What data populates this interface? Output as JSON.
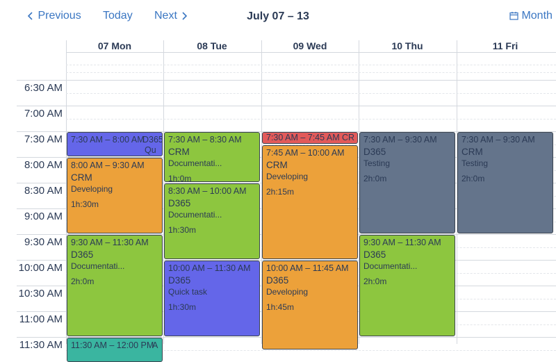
{
  "toolbar": {
    "previous_label": "Previous",
    "today_label": "Today",
    "next_label": "Next",
    "title": "July 07 – 13",
    "month_label": "Month"
  },
  "days": [
    {
      "label": "07 Mon"
    },
    {
      "label": "08 Tue"
    },
    {
      "label": "09 Wed"
    },
    {
      "label": "10 Thu"
    },
    {
      "label": "11 Fri"
    }
  ],
  "times": [
    "6:30 AM",
    "7:00 AM",
    "7:30 AM",
    "8:00 AM",
    "8:30 AM",
    "9:00 AM",
    "9:30 AM",
    "10:00 AM",
    "10:30 AM",
    "11:00 AM",
    "11:30 AM"
  ],
  "colors": {
    "purple": "#6466e9",
    "orange": "#eca13a",
    "green": "#8dc63f",
    "red": "#e25a5a",
    "slate": "#64748b",
    "teal": "#3ab5a0",
    "accent": "#3a76c2"
  },
  "events": [
    {
      "day": 0,
      "start": 7.5,
      "end": 8.0,
      "color": "purple",
      "time": "7:30 AM – 8:00 AM",
      "inline": "D365",
      "extra": "Qu",
      "title": "",
      "type": "",
      "duration": ""
    },
    {
      "day": 0,
      "start": 8.0,
      "end": 9.5,
      "color": "orange",
      "time": "8:00 AM – 9:30 AM",
      "title": "CRM",
      "type": "Developing",
      "duration": "1h:30m"
    },
    {
      "day": 0,
      "start": 9.5,
      "end": 11.5,
      "color": "green",
      "time": "9:30 AM – 11:30 AM",
      "title": "D365",
      "type": "Documentati...",
      "duration": "2h:0m"
    },
    {
      "day": 0,
      "start": 11.5,
      "end": 12.0,
      "color": "teal",
      "time": "11:30 AM – 12:00 PM",
      "inline": "A",
      "title": "",
      "type": "",
      "duration": ""
    },
    {
      "day": 1,
      "start": 7.5,
      "end": 8.5,
      "color": "green",
      "time": "7:30 AM – 8:30 AM",
      "title": "CRM",
      "type": "Documentati...",
      "duration": "1h:0m"
    },
    {
      "day": 1,
      "start": 8.5,
      "end": 10.0,
      "color": "green",
      "time": "8:30 AM – 10:00 AM",
      "title": "D365",
      "type": "Documentati...",
      "duration": "1h:30m"
    },
    {
      "day": 1,
      "start": 10.0,
      "end": 11.5,
      "color": "purple",
      "time": "10:00 AM – 11:30 AM",
      "title": "D365",
      "type": "Quick task",
      "duration": "1h:30m"
    },
    {
      "day": 2,
      "start": 7.5,
      "end": 7.75,
      "color": "red",
      "time": "7:30 AM – 7:45 AM",
      "inline": "CR",
      "title": "",
      "type": "",
      "duration": ""
    },
    {
      "day": 2,
      "start": 7.75,
      "end": 10.0,
      "color": "orange",
      "time": "7:45 AM – 10:00 AM",
      "title": "CRM",
      "type": "Developing",
      "duration": "2h:15m"
    },
    {
      "day": 2,
      "start": 10.0,
      "end": 11.75,
      "color": "orange",
      "time": "10:00 AM – 11:45 AM",
      "title": "D365",
      "type": "Developing",
      "duration": "1h:45m"
    },
    {
      "day": 3,
      "start": 7.5,
      "end": 9.5,
      "color": "slate",
      "time": "7:30 AM – 9:30 AM",
      "title": "D365",
      "type": "Testing",
      "duration": "2h:0m"
    },
    {
      "day": 3,
      "start": 9.5,
      "end": 11.5,
      "color": "green",
      "time": "9:30 AM – 11:30 AM",
      "title": "D365",
      "type": "Documentati...",
      "duration": "2h:0m"
    },
    {
      "day": 4,
      "start": 7.5,
      "end": 9.5,
      "color": "slate",
      "time": "7:30 AM – 9:30 AM",
      "title": "CRM",
      "type": "Testing",
      "duration": "2h:0m"
    }
  ]
}
